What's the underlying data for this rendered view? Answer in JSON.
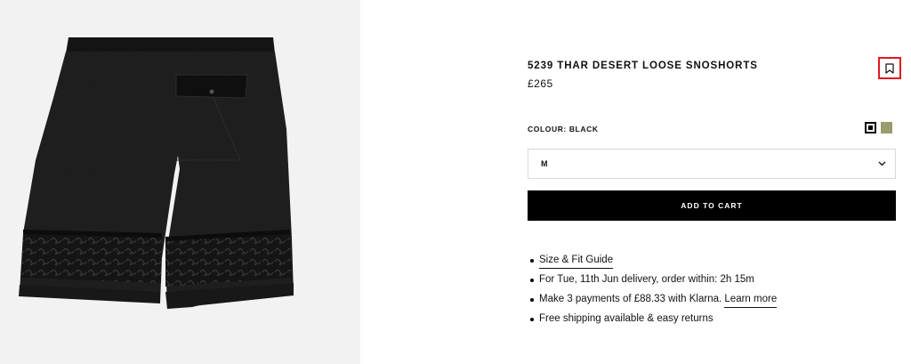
{
  "gallery": {
    "image_alt": "Black loose shorts with embroidered hem, rear view"
  },
  "product": {
    "title": "5239  THAR DESERT LOOSE SNOSHORTS",
    "price": "£265",
    "colour_label": "COLOUR: BLACK",
    "swatches": [
      {
        "name": "black",
        "color": "#000000",
        "selected": true
      },
      {
        "name": "olive",
        "color": "#9a9c6e",
        "selected": false
      }
    ],
    "size_value": "M",
    "add_to_cart_label": "ADD TO CART"
  },
  "info": {
    "size_guide": "Size & Fit Guide",
    "delivery": "For Tue, 11th Jun delivery, order within: 2h 15m",
    "klarna_text": "Make 3 payments of £88.33 with Klarna.",
    "klarna_link": "Learn more",
    "shipping": "Free shipping available & easy returns"
  },
  "colors": {
    "accent_outline": "#e0191f",
    "button_bg": "#000000"
  }
}
